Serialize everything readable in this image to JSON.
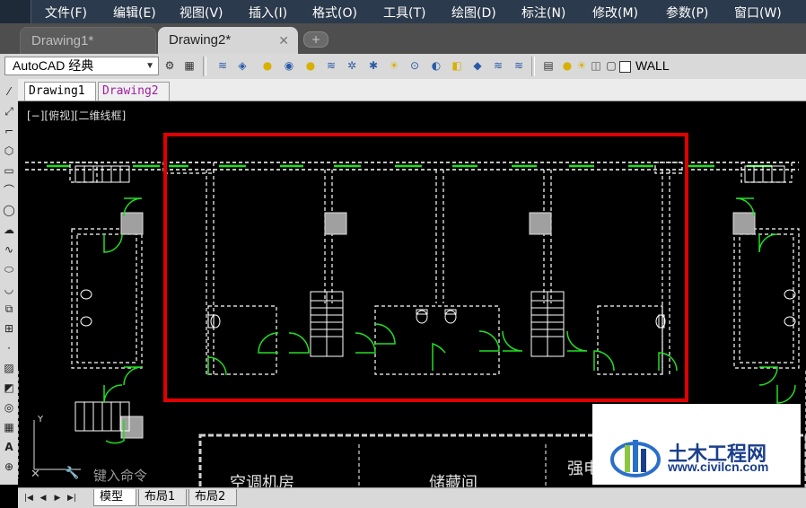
{
  "menu": [
    "文件(F)",
    "编辑(E)",
    "视图(V)",
    "插入(I)",
    "格式(O)",
    "工具(T)",
    "绘图(D)",
    "标注(N)",
    "修改(M)",
    "参数(P)",
    "窗口(W)"
  ],
  "file_tabs": [
    {
      "label": "Drawing1*",
      "active": false
    },
    {
      "label": "Drawing2*",
      "active": true
    }
  ],
  "new_tab_symbol": "+",
  "close_symbol": "✕",
  "toolbar": {
    "workspace": "AutoCAD 经典",
    "layer_name": "WALL"
  },
  "doc_tabs": [
    "Drawing1",
    "Drawing2"
  ],
  "view_label": "[−][俯视][二维线框]",
  "command": {
    "close": "✕",
    "prompt": "键入命令"
  },
  "layout_tabs": [
    {
      "label": "模型",
      "active": true
    },
    {
      "label": "布局1",
      "active": false
    },
    {
      "label": "布局2",
      "active": false
    }
  ],
  "drawing_labels": [
    "空调机房",
    "储藏间",
    "强电"
  ],
  "watermark": {
    "name": "土木工程网",
    "url": "www.civilcn.com"
  },
  "colors": {
    "highlight_box": "#e00000",
    "door_green": "#22dd22",
    "wall_white": "#ffffff",
    "column_gray": "#a0a0a0",
    "menubar": "#2b3a4c"
  },
  "icons": [
    "gear-icon",
    "layer-icon",
    "lightbulb-icon",
    "sun-icon",
    "lock-icon"
  ]
}
